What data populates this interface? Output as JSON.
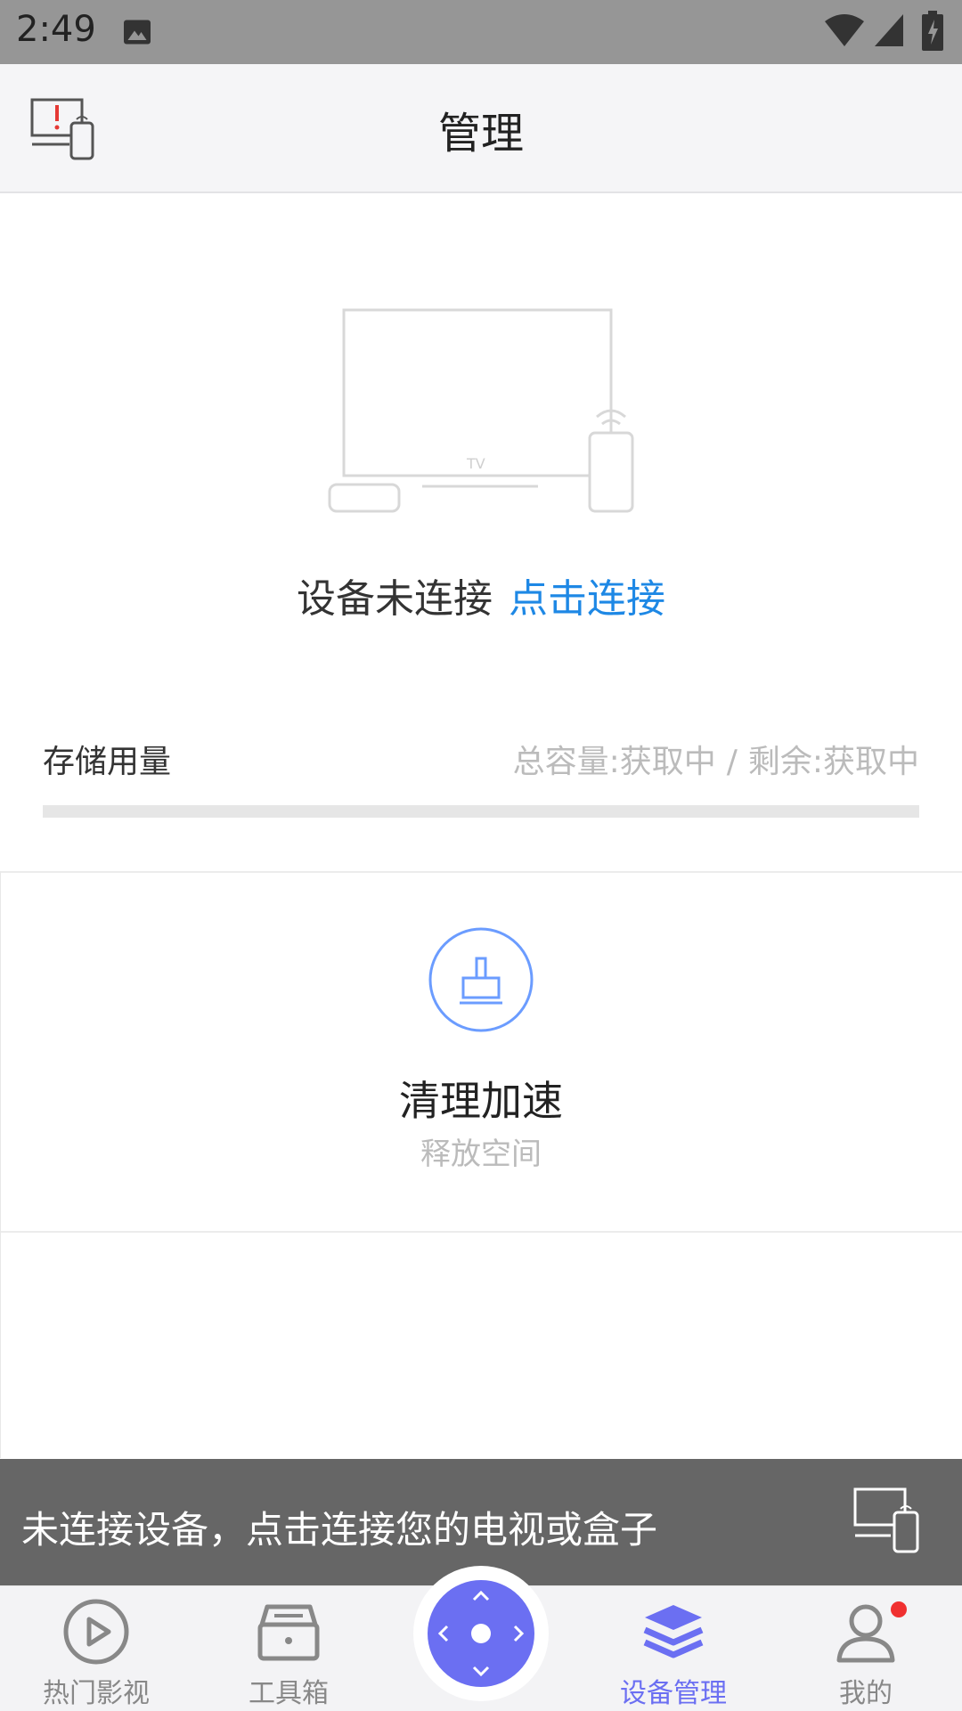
{
  "status_bar": {
    "time": "2:49"
  },
  "header": {
    "title": "管理"
  },
  "device": {
    "status_text": "设备未连接",
    "connect_link": "点击连接"
  },
  "storage": {
    "label": "存储用量",
    "total": "总容量:获取中",
    "separator": "/",
    "remaining": "剩余:获取中",
    "used_fraction": 0
  },
  "clean": {
    "title": "清理加速",
    "subtitle": "释放空间"
  },
  "banner": {
    "text": "未连接设备，点击连接您的电视或盒子"
  },
  "bottom_nav": {
    "items": [
      {
        "label": "热门影视",
        "icon": "play-circle-icon"
      },
      {
        "label": "工具箱",
        "icon": "toolbox-icon"
      },
      {
        "label": "",
        "icon": "remote-control-icon"
      },
      {
        "label": "设备管理",
        "icon": "layers-icon",
        "active": true
      },
      {
        "label": "我的",
        "icon": "user-icon",
        "badge": true
      }
    ]
  },
  "colors": {
    "accent": "#6b6ff2",
    "link": "#1e88e5",
    "status_bar": "#969696",
    "banner": "#666666",
    "badge": "#f03030",
    "clean_icon": "#6b9cff"
  }
}
